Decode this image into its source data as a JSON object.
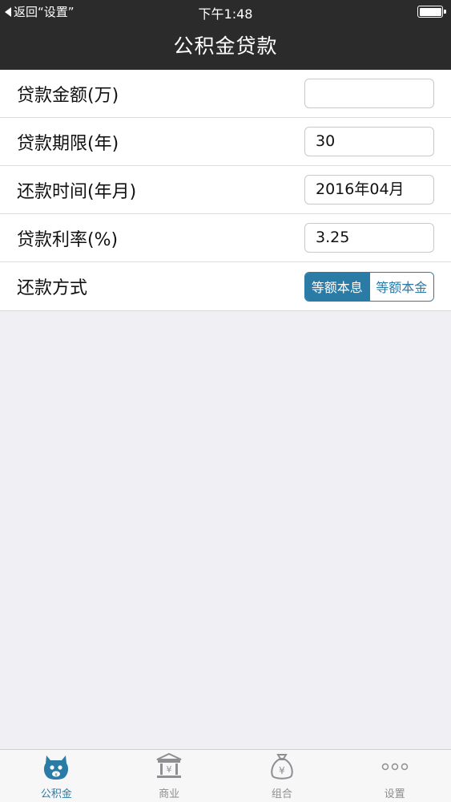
{
  "status_bar": {
    "back_app_label": "返回“设置”",
    "time": "下午1:48"
  },
  "nav": {
    "title": "公积金贷款"
  },
  "form": {
    "loan_amount": {
      "label": "贷款金额(万)",
      "value": ""
    },
    "loan_term": {
      "label": "贷款期限(年)",
      "value": "30"
    },
    "repay_start": {
      "label": "还款时间(年月)",
      "value": "2016年04月"
    },
    "interest_rate": {
      "label": "贷款利率(%)",
      "value": "3.25"
    },
    "repay_method": {
      "label": "还款方式",
      "options": [
        "等额本息",
        "等额本金"
      ],
      "selected": "等额本息"
    }
  },
  "tabbar": {
    "items": [
      {
        "label": "公积金",
        "icon": "piggy-bank-icon",
        "active": true
      },
      {
        "label": "商业",
        "icon": "bank-icon",
        "active": false
      },
      {
        "label": "组合",
        "icon": "money-bag-icon",
        "active": false
      },
      {
        "label": "设置",
        "icon": "more-icon",
        "active": false
      }
    ]
  },
  "colors": {
    "accent": "#2a7ba6",
    "nav_bg": "#2b2b2b",
    "page_bg": "#efeff4",
    "tab_inactive": "#8e8e93"
  }
}
